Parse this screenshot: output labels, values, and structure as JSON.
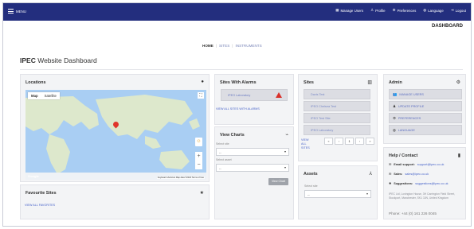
{
  "topbar": {
    "menu_label": "MENU",
    "nav": [
      {
        "icon": "grid-icon",
        "label": "Manage Users"
      },
      {
        "icon": "user-icon",
        "label": "Profile"
      },
      {
        "icon": "gear-icon",
        "label": "Preferences"
      },
      {
        "icon": "globe-icon",
        "label": "Language"
      },
      {
        "icon": "logout-icon",
        "label": "Logout"
      }
    ]
  },
  "header": {
    "dashboard_label": "DASHBOARD"
  },
  "breadcrumb": [
    "HOME",
    "SITES",
    "INSTRUMENTS"
  ],
  "page_title": {
    "brand": "IPEC",
    "rest": " Website Dashboard"
  },
  "locations": {
    "title": "Locations",
    "map_types": [
      "Map",
      "Satellite"
    ],
    "attribution": "Keyboard shortcuts  Map data ©2023  Terms of Use",
    "google": "Google"
  },
  "favourites": {
    "title": "Favourite Sites",
    "link": "VIEW ALL FAVORITES"
  },
  "alarms": {
    "title": "Sites With Alarms",
    "site": "IPEO Laboratory",
    "link": "VIEW ALL SITES WITH ALARMS"
  },
  "charts": {
    "title": "View Charts",
    "site_label": "Select site",
    "site_value": "--",
    "asset_label": "Select asset",
    "asset_value": "--",
    "button": "View Chart"
  },
  "sites": {
    "title": "Sites",
    "items": [
      "Davis Test",
      "IPEO Chelsea Test",
      "IPEO Test Site",
      "IPEO Laboratory"
    ],
    "view_all": "VIEW ALL SITES",
    "pager": [
      "«",
      "‹",
      "1",
      "›",
      "»"
    ]
  },
  "assets": {
    "title": "Assets",
    "site_label": "Select site",
    "site_value": "--"
  },
  "admin": {
    "title": "Admin",
    "items": [
      {
        "icon": "users-icon",
        "label": "MANAGE USERS"
      },
      {
        "icon": "user-icon",
        "label": "UPDATE PROFILE"
      },
      {
        "icon": "gear-icon",
        "label": "PREFERENCES"
      },
      {
        "icon": "globe-icon",
        "label": "LANGUAGE"
      }
    ]
  },
  "contact": {
    "title": "Help / Contact",
    "email_label": "Email support:",
    "email": "support@ipec.co.uk",
    "sales_label": "Sales:",
    "sales": "sales@ipec.co.uk",
    "suggest_label": "Suggestions:",
    "suggest": "suggestions@ipec.co.uk",
    "address": "IPEC Ltd, Lovington House, 3H Carrington Field Street, Stockport, Manchester, SK1 3JN, United Kingdom",
    "phone": "Phone: +44 (0) 161 226 0045"
  },
  "colors": {
    "topbar": "#232e7e",
    "link": "#4763c9",
    "alarm": "#d9302a"
  }
}
